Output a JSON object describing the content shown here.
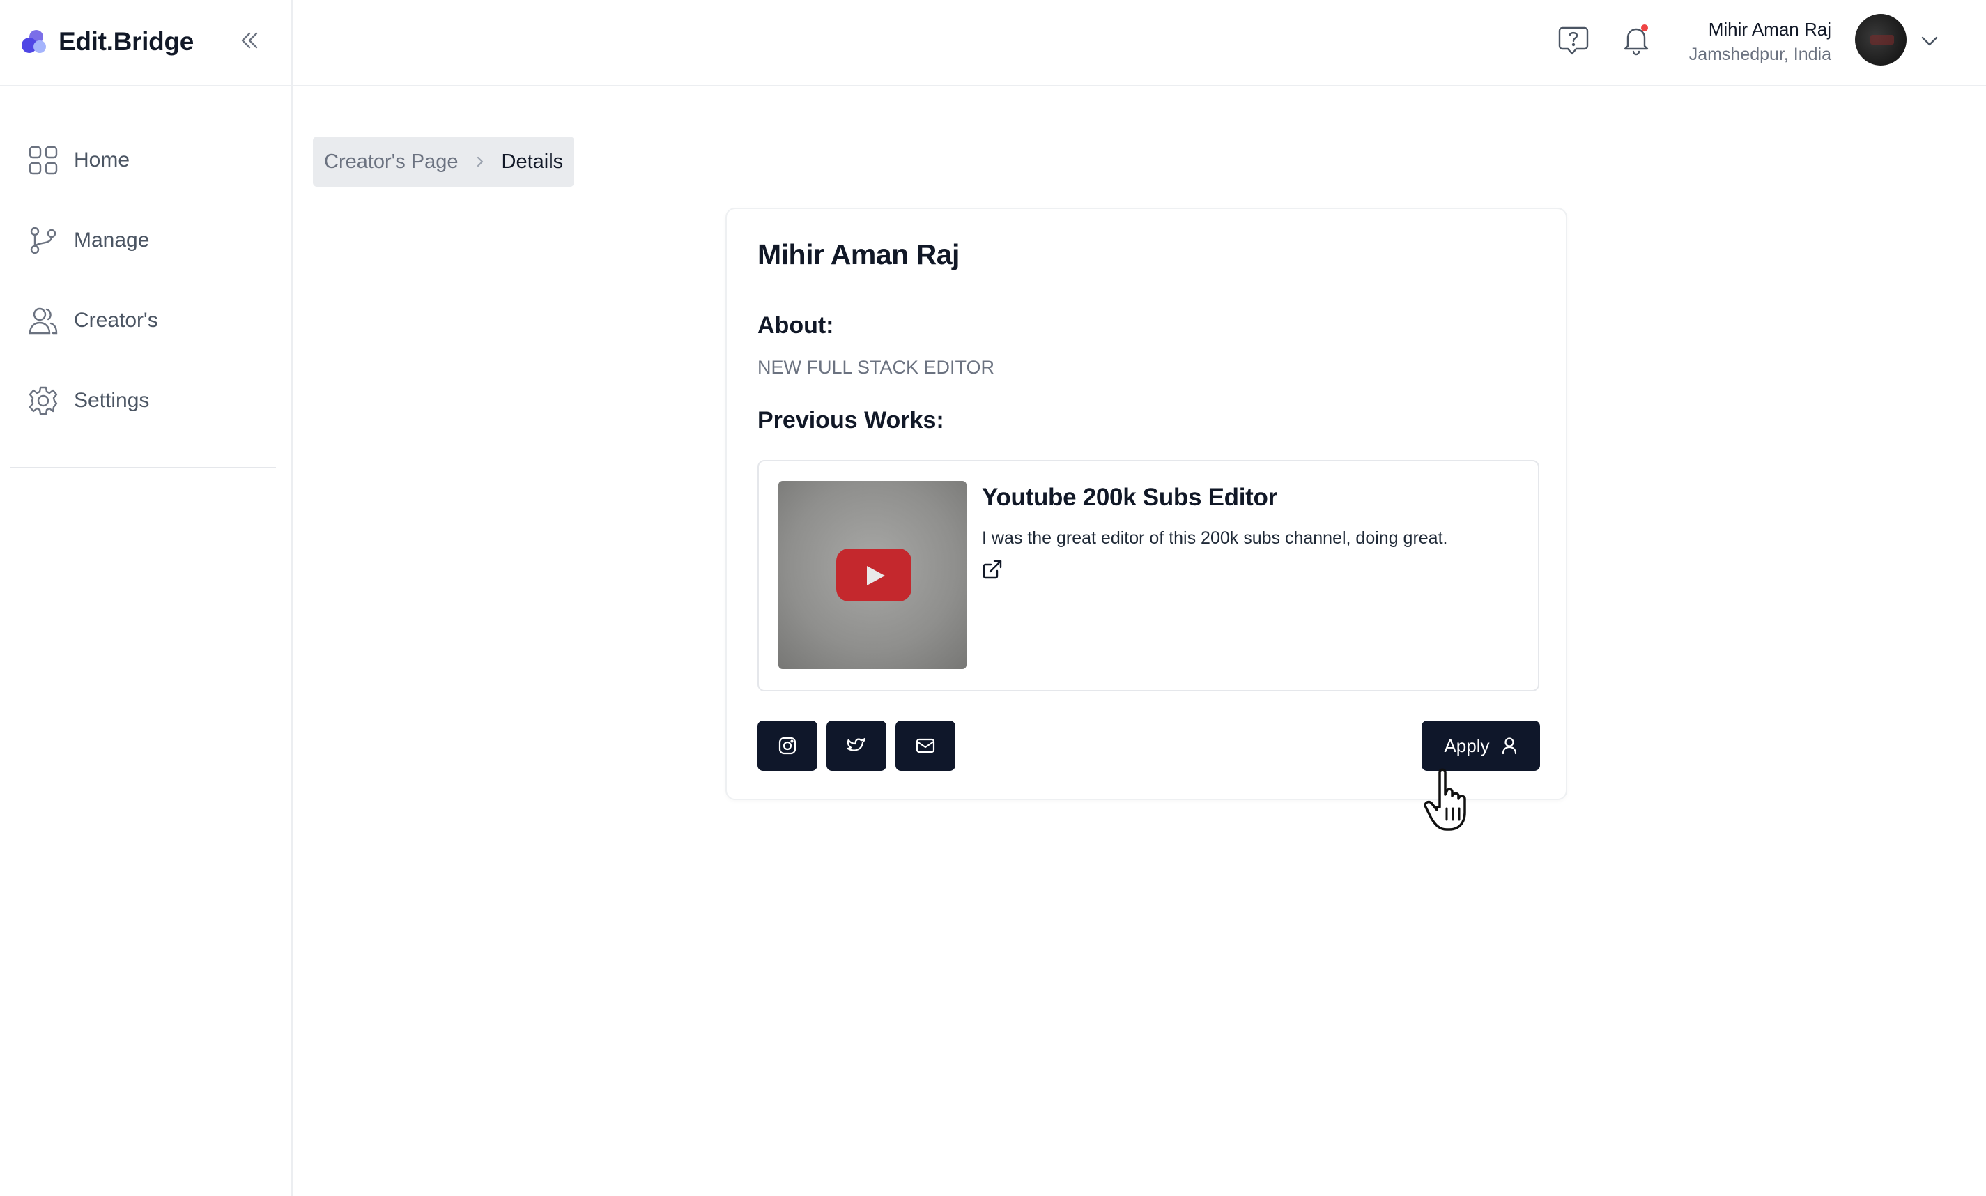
{
  "app": {
    "name": "Edit.Bridge"
  },
  "sidebar": {
    "items": [
      {
        "label": "Home",
        "icon": "grid-icon"
      },
      {
        "label": "Manage",
        "icon": "git-branch-icon"
      },
      {
        "label": "Creator's",
        "icon": "users-icon"
      },
      {
        "label": "Settings",
        "icon": "gear-icon"
      }
    ]
  },
  "header": {
    "user_name": "Mihir Aman Raj",
    "user_location": "Jamshedpur, India",
    "notification_dot_color": "#ef4444"
  },
  "breadcrumb": {
    "parent": "Creator's Page",
    "current": "Details"
  },
  "profile": {
    "name": "Mihir Aman Raj",
    "about_heading": "About:",
    "about_text": "NEW FULL STACK EDITOR",
    "works_heading": "Previous Works:",
    "works": [
      {
        "title": "Youtube 200k Subs Editor",
        "description": "I was the great editor of this 200k subs channel, doing great."
      }
    ],
    "apply_label": "Apply"
  },
  "colors": {
    "brand_logo": "#5b4fd6",
    "button_bg": "#0f172a",
    "youtube_red": "#c4282d"
  }
}
